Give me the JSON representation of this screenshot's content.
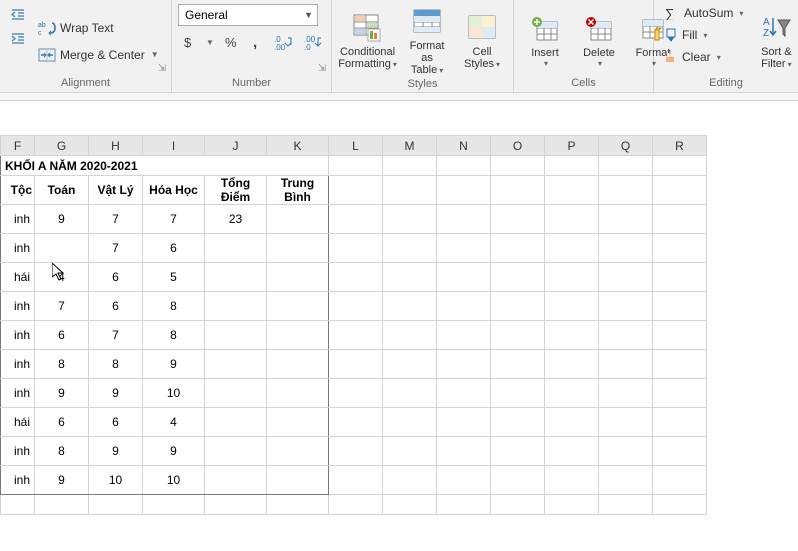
{
  "ribbon": {
    "alignment": {
      "wrap": "Wrap Text",
      "merge": "Merge & Center",
      "label": "Alignment"
    },
    "number": {
      "format_value": "General",
      "label": "Number"
    },
    "styles": {
      "cond": "Conditional Formatting",
      "table": "Format as Table",
      "cell": "Cell Styles",
      "label": "Styles"
    },
    "cells": {
      "insert": "Insert",
      "delete": "Delete",
      "format": "Format",
      "label": "Cells"
    },
    "editing": {
      "autosum": "AutoSum",
      "fill": "Fill",
      "clear": "Clear",
      "sort": "Sort & Filter",
      "label": "Editing"
    }
  },
  "columns": [
    "F",
    "G",
    "H",
    "I",
    "J",
    "K",
    "L",
    "M",
    "N",
    "O",
    "P",
    "Q",
    "R"
  ],
  "title_text": "KHỐI A NĂM 2020-2021",
  "headers": {
    "f": "Tộc",
    "g": "Toán",
    "h": "Vật Lý",
    "i": "Hóa Học",
    "j": "Tổng Điểm",
    "k": "Trung Bình"
  },
  "chart_data": {
    "type": "table",
    "title": "KHỐI A NĂM 2020-2021",
    "columns": [
      "Tộc",
      "Toán",
      "Vật Lý",
      "Hóa Học",
      "Tổng Điểm",
      "Trung Bình"
    ],
    "rows": [
      {
        "f": "inh",
        "g": 9,
        "h": 7,
        "i": 7,
        "j": 23,
        "k": ""
      },
      {
        "f": "inh",
        "g": "",
        "h": 7,
        "i": 6,
        "j": "",
        "k": ""
      },
      {
        "f": "hái",
        "g": 4,
        "h": 6,
        "i": 5,
        "j": "",
        "k": ""
      },
      {
        "f": "inh",
        "g": 7,
        "h": 6,
        "i": 8,
        "j": "",
        "k": ""
      },
      {
        "f": "inh",
        "g": 6,
        "h": 7,
        "i": 8,
        "j": "",
        "k": ""
      },
      {
        "f": "inh",
        "g": 8,
        "h": 8,
        "i": 9,
        "j": "",
        "k": ""
      },
      {
        "f": "inh",
        "g": 9,
        "h": 9,
        "i": 10,
        "j": "",
        "k": ""
      },
      {
        "f": "hái",
        "g": 6,
        "h": 6,
        "i": 4,
        "j": "",
        "k": ""
      },
      {
        "f": "inh",
        "g": 8,
        "h": 9,
        "i": 9,
        "j": "",
        "k": ""
      },
      {
        "f": "inh",
        "g": 9,
        "h": 10,
        "i": 10,
        "j": "",
        "k": ""
      }
    ]
  }
}
